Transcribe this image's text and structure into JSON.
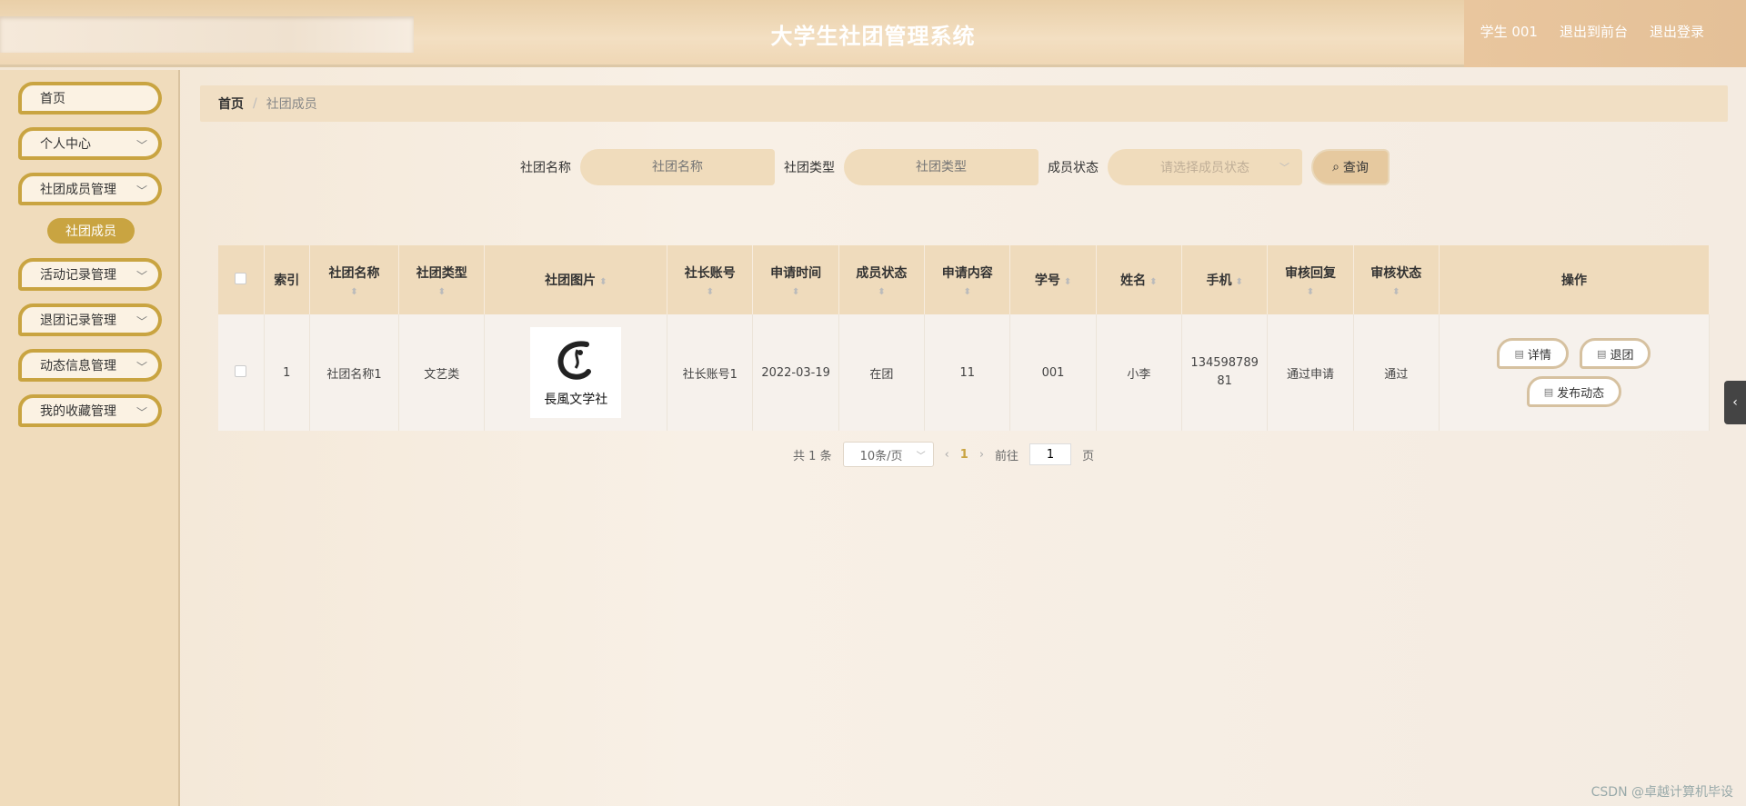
{
  "header": {
    "title": "大学生社团管理系统",
    "user_label": "学生 001",
    "back_to_front": "退出到前台",
    "logout": "退出登录"
  },
  "sidebar": {
    "items": [
      {
        "label": "首页",
        "has_chevron": false
      },
      {
        "label": "个人中心",
        "has_chevron": true
      },
      {
        "label": "社团成员管理",
        "has_chevron": true
      },
      {
        "label": "活动记录管理",
        "has_chevron": true
      },
      {
        "label": "退团记录管理",
        "has_chevron": true
      },
      {
        "label": "动态信息管理",
        "has_chevron": true
      },
      {
        "label": "我的收藏管理",
        "has_chevron": true
      }
    ],
    "active_sub": "社团成员"
  },
  "breadcrumb": {
    "home": "首页",
    "separator": "/",
    "current": "社团成员"
  },
  "search": {
    "club_name_label": "社团名称",
    "club_name_placeholder": "社团名称",
    "club_type_label": "社团类型",
    "club_type_placeholder": "社团类型",
    "member_status_label": "成员状态",
    "member_status_placeholder": "请选择成员状态",
    "query_button": "查询"
  },
  "table": {
    "headers": {
      "index": "索引",
      "club_name": "社团名称",
      "club_type": "社团类型",
      "club_image": "社团图片",
      "leader_account": "社长账号",
      "apply_time": "申请时间",
      "member_status": "成员状态",
      "apply_content": "申请内容",
      "student_no": "学号",
      "name": "姓名",
      "phone": "手机",
      "review_reply": "审核回复",
      "review_status": "审核状态",
      "actions": "操作"
    },
    "rows": [
      {
        "index": "1",
        "club_name": "社团名称1",
        "club_type": "文艺类",
        "image_caption": "長風文学社",
        "leader_account": "社长账号1",
        "apply_time": "2022-03-19",
        "member_status": "在团",
        "apply_content": "11",
        "student_no": "001",
        "name": "小李",
        "phone": "13459878981",
        "review_reply": "通过申请",
        "review_status": "通过",
        "actions": {
          "detail": "详情",
          "quit": "退团",
          "publish": "发布动态"
        }
      }
    ]
  },
  "pagination": {
    "total_prefix": "共",
    "total": "1",
    "total_suffix": "条",
    "page_size": "10条/页",
    "current_page": "1",
    "goto_prefix": "前往",
    "goto_value": "1",
    "goto_suffix": "页"
  },
  "watermark": "CSDN @卓越计算机毕设",
  "colors": {
    "accent": "#c9a441",
    "header": "#ecd3ae",
    "sidebar": "#f0dcbc"
  }
}
